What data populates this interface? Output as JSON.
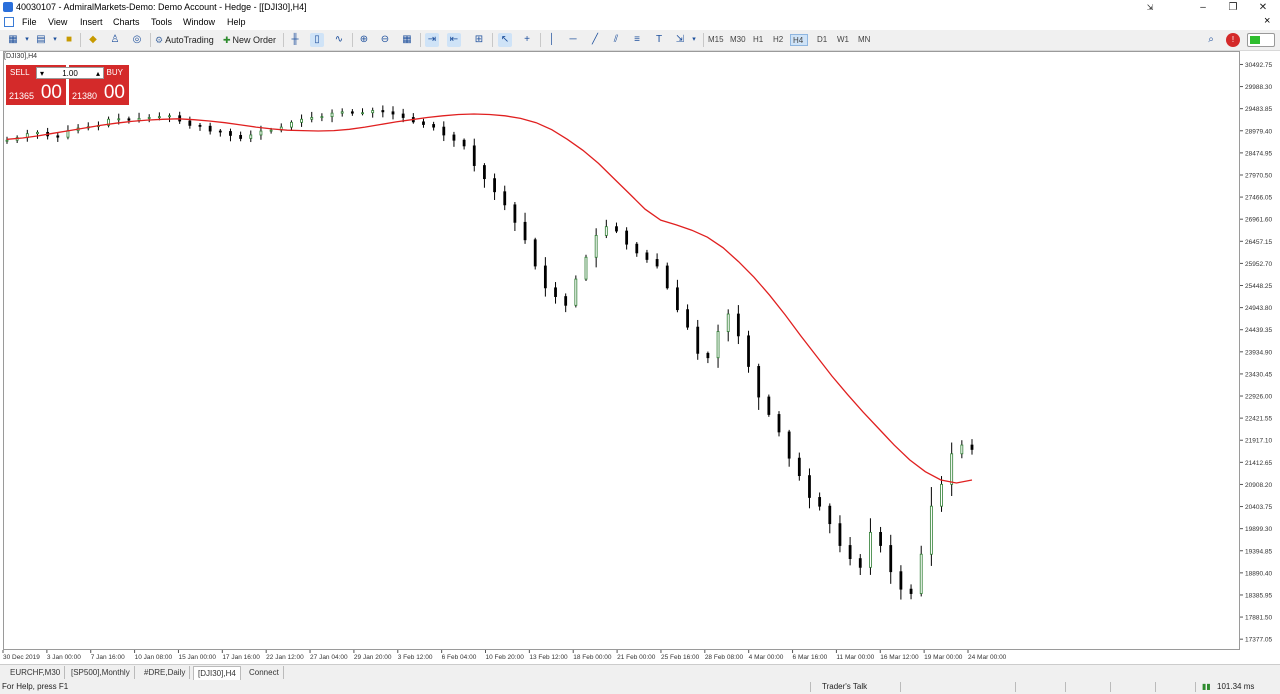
{
  "window": {
    "title": "40030107 - AdmiralMarkets-Demo: Demo Account - Hedge - [[DJI30],H4]"
  },
  "menu": [
    "File",
    "View",
    "Insert",
    "Charts",
    "Tools",
    "Window",
    "Help"
  ],
  "toolbar": {
    "autotrading_label": "AutoTrading",
    "neworder_label": "New Order",
    "timeframes": [
      "M15",
      "M30",
      "H1",
      "H2",
      "H4",
      "D1",
      "W1",
      "MN"
    ],
    "active_timeframe": "H4"
  },
  "chart": {
    "title": "[DJI30],H4",
    "price_labels": [
      "30492.75",
      "29988.30",
      "29483.85",
      "28979.40",
      "28474.95",
      "27970.50",
      "27466.05",
      "26961.60",
      "26457.15",
      "25952.70",
      "25448.25",
      "24943.80",
      "24439.35",
      "23934.90",
      "23430.45",
      "22926.00",
      "22421.55",
      "21917.10",
      "21412.65",
      "20908.20",
      "20403.75",
      "19899.30",
      "19394.85",
      "18890.40",
      "18385.95",
      "17881.50",
      "17377.05"
    ],
    "price_range": [
      17130,
      30800
    ],
    "time_labels": [
      "30 Dec 2019",
      "3 Jan 00:00",
      "7 Jan 16:00",
      "10 Jan 08:00",
      "15 Jan 00:00",
      "17 Jan 16:00",
      "22 Jan 12:00",
      "27 Jan 04:00",
      "29 Jan 20:00",
      "3 Feb 12:00",
      "6 Feb 04:00",
      "10 Feb 20:00",
      "13 Feb 12:00",
      "18 Feb 00:00",
      "21 Feb 00:00",
      "25 Feb 16:00",
      "28 Feb 08:00",
      "4 Mar 00:00",
      "6 Mar 16:00",
      "11 Mar 00:00",
      "16 Mar 12:00",
      "19 Mar 00:00",
      "24 Mar 00:00"
    ],
    "bullish_color": "#2e7d32",
    "bearish_color": "#000000",
    "ma_color": "#e02020"
  },
  "chart_data": {
    "type": "line",
    "title": "[DJI30],H4",
    "xlabel": "",
    "ylabel": "",
    "ylim": [
      17130,
      30800
    ],
    "grid": false,
    "series": [
      {
        "values": [
          28780,
          28840,
          28930,
          28960,
          28880,
          28850,
          29000,
          29060,
          29090,
          29120,
          29260,
          29270,
          29240,
          29280,
          29300,
          29320,
          29340,
          29220,
          29120,
          29100,
          28990,
          28980,
          28890,
          28820,
          28900,
          28990,
          29010,
          29080,
          29190,
          29260,
          29300,
          29320,
          29400,
          29430,
          29400,
          29410,
          29460,
          29430,
          29380,
          29300,
          29200,
          29140,
          29080,
          28900,
          28780,
          28650,
          28200,
          27900,
          27600,
          27300,
          26900,
          26500,
          25900,
          25400,
          25200,
          25000,
          25600,
          26100,
          26600,
          26800,
          26700,
          26400,
          26200,
          26050,
          25900,
          25400,
          24900,
          24500,
          23900,
          23800,
          24400,
          24800,
          24300,
          23600,
          22900,
          22500,
          22100,
          21500,
          21100,
          20600,
          20400,
          20000,
          19500,
          19200,
          19000,
          19800,
          19500,
          18900,
          18500,
          18400,
          19300,
          20400,
          20900,
          21600,
          21800,
          21700
        ]
      },
      {
        "values": [
          28800,
          28830,
          28880,
          28940,
          29000,
          29060,
          29120,
          29170,
          29210,
          29240,
          29260,
          29270,
          29250,
          29220,
          29180,
          29130,
          29080,
          29040,
          29010,
          29000,
          28990,
          29000,
          29030,
          29080,
          29140,
          29200,
          29250,
          29300,
          29340,
          29370,
          29380,
          29370,
          29340,
          29280,
          29180,
          29020,
          28800,
          28550,
          28250,
          27900,
          27550,
          27200,
          26950,
          26840,
          26720,
          26560,
          26320,
          26000,
          25640,
          25230,
          24780,
          24300,
          23840,
          23380,
          22960,
          22560,
          22180,
          21800,
          21460,
          21190,
          21000,
          20930,
          21000
        ]
      }
    ]
  },
  "oneclick": {
    "sell_label": "SELL",
    "buy_label": "BUY",
    "lot": "1.00",
    "sell_small": "21365",
    "sell_big": "00",
    "buy_small": "21380",
    "buy_big": "00"
  },
  "tabs": [
    "EURCHF,M30",
    "[SP500],Monthly",
    "#DRE,Daily",
    "[DJI30],H4",
    "Connect"
  ],
  "active_tab": "[DJI30],H4",
  "status": {
    "help": "For Help, press F1",
    "profile": "Trader's Talk",
    "ping": "101.34 ms"
  }
}
